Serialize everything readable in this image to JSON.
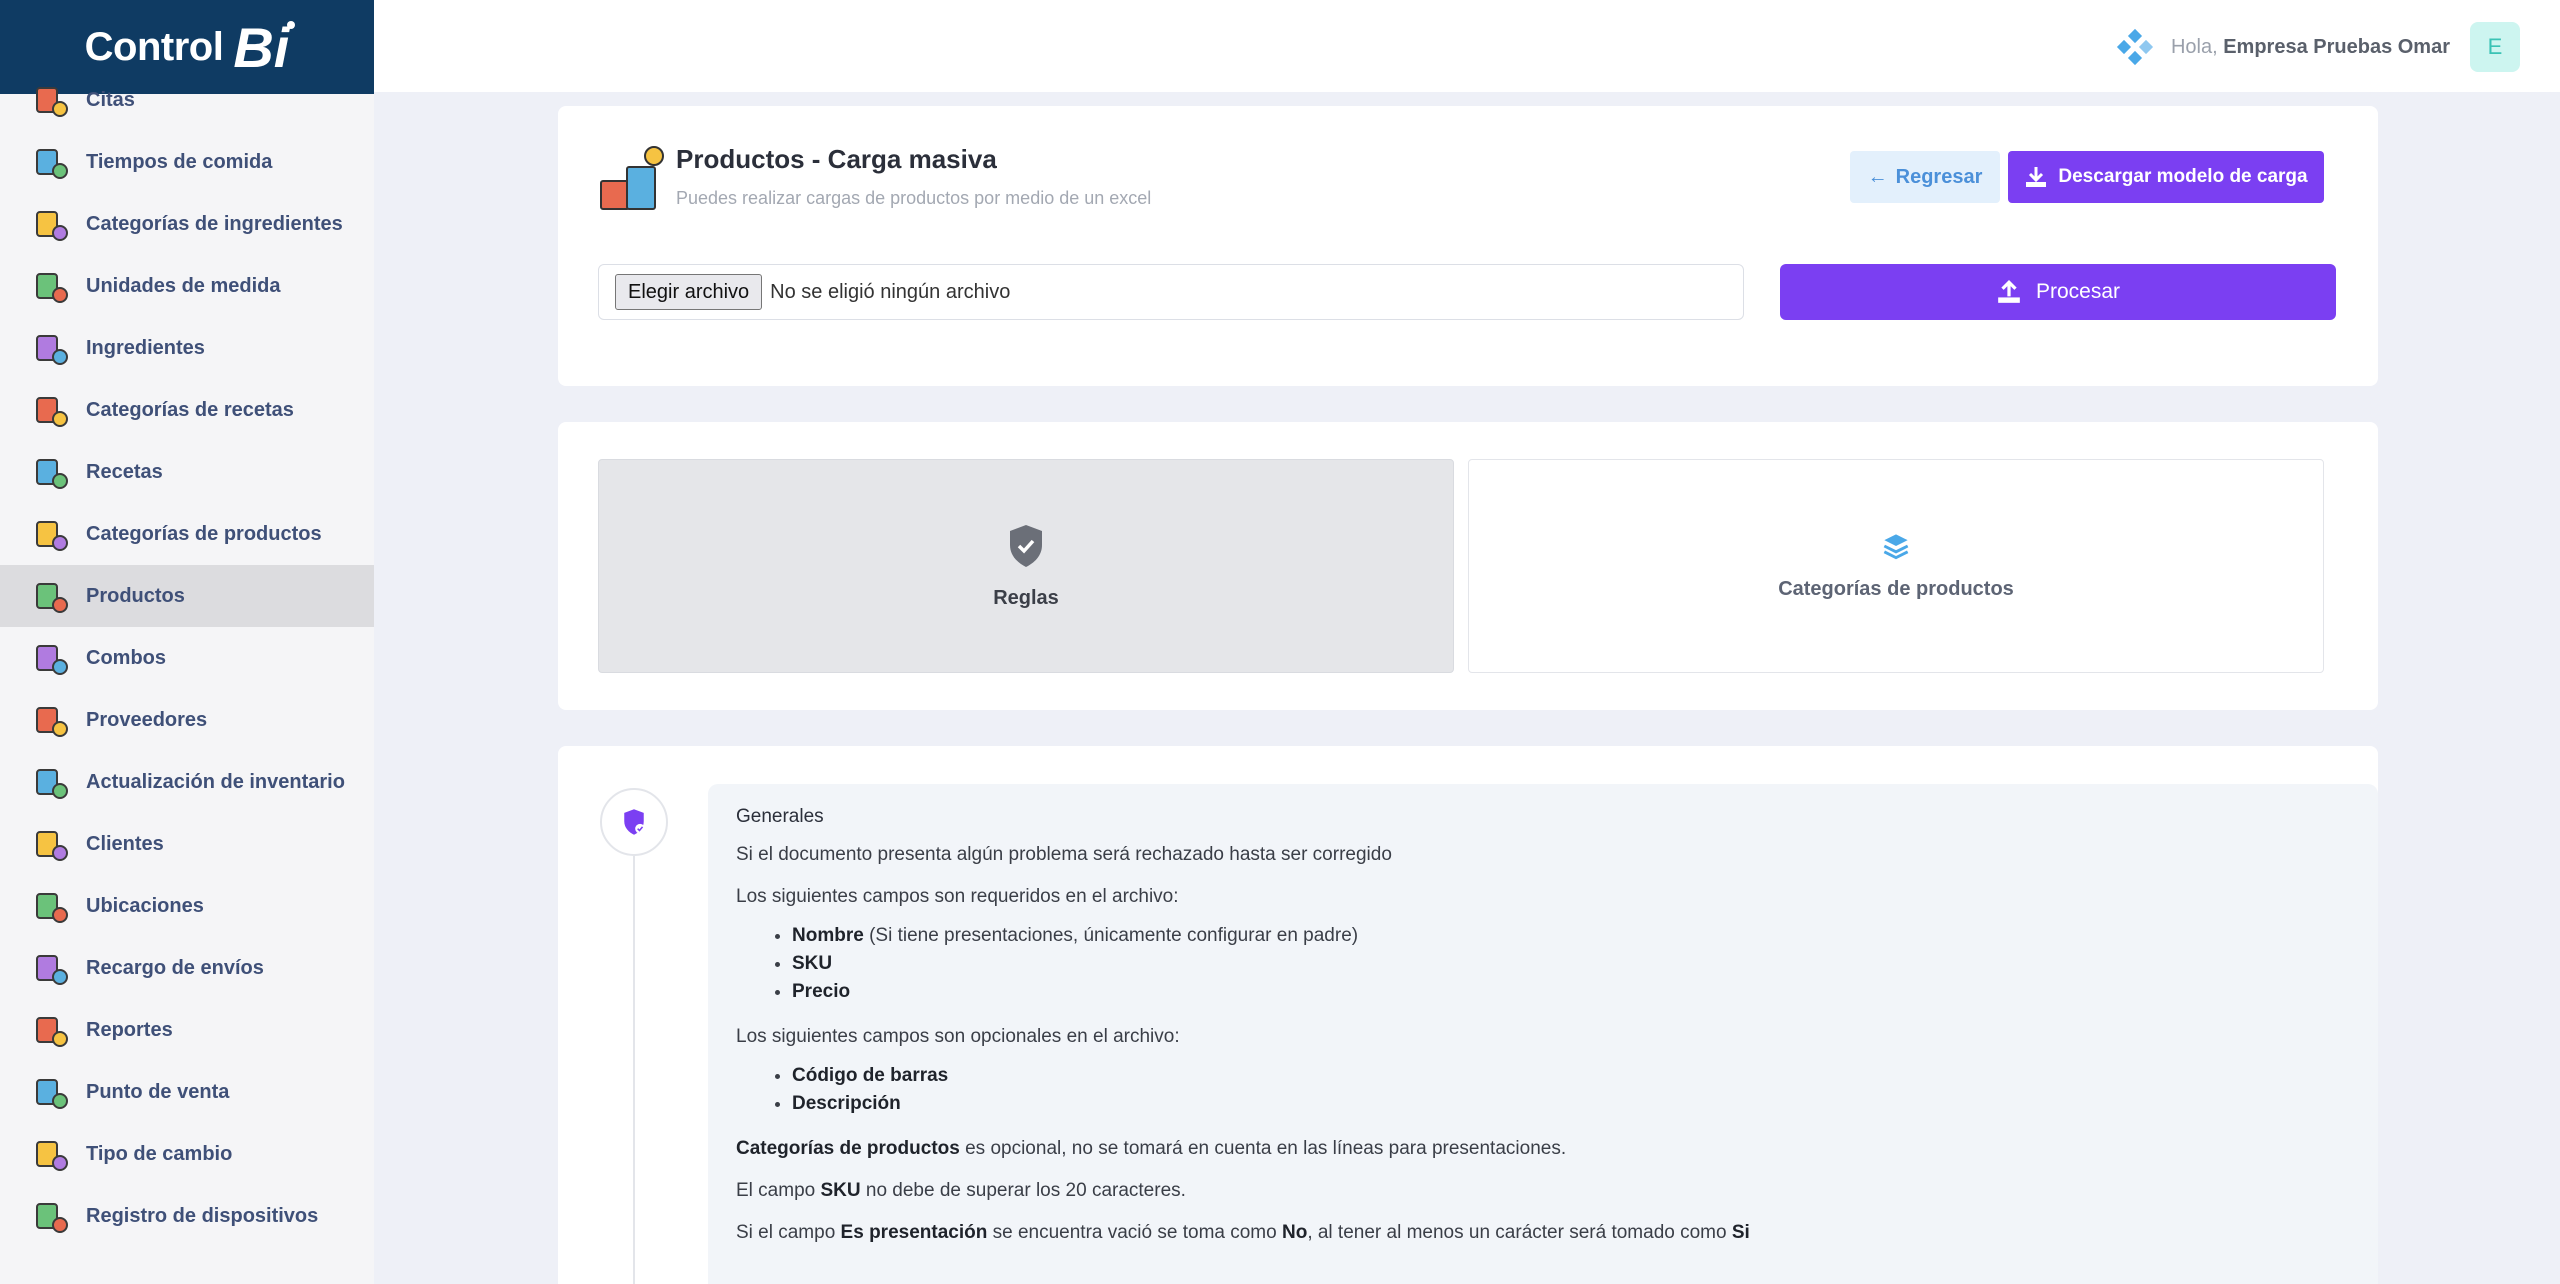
{
  "brand": {
    "text": "Control",
    "mark": "Bi"
  },
  "sidebar": {
    "items": [
      {
        "label": "Citas",
        "icon": "calendar-icon"
      },
      {
        "label": "Tiempos de comida",
        "icon": "plate-icon"
      },
      {
        "label": "Categorías de ingredientes",
        "icon": "ingredients-icon"
      },
      {
        "label": "Unidades de medida",
        "icon": "measure-icon"
      },
      {
        "label": "Ingredientes",
        "icon": "jars-icon"
      },
      {
        "label": "Categorías de recetas",
        "icon": "recipe-book-icon"
      },
      {
        "label": "Recetas",
        "icon": "recipe-icon"
      },
      {
        "label": "Categorías de productos",
        "icon": "product-categories-icon"
      },
      {
        "label": "Productos",
        "icon": "products-icon"
      },
      {
        "label": "Combos",
        "icon": "combo-icon"
      },
      {
        "label": "Proveedores",
        "icon": "supplier-icon"
      },
      {
        "label": "Actualización de inventario",
        "icon": "inventory-icon"
      },
      {
        "label": "Clientes",
        "icon": "clients-icon"
      },
      {
        "label": "Ubicaciones",
        "icon": "location-icon"
      },
      {
        "label": "Recargo de envíos",
        "icon": "delivery-icon"
      },
      {
        "label": "Reportes",
        "icon": "reports-icon"
      },
      {
        "label": "Punto de venta",
        "icon": "pos-icon"
      },
      {
        "label": "Tipo de cambio",
        "icon": "exchange-icon"
      },
      {
        "label": "Registro de dispositivos",
        "icon": "devices-icon"
      }
    ],
    "active": "Productos"
  },
  "topbar": {
    "greeting_prefix": "Hola, ",
    "user_name": "Empresa Pruebas Omar",
    "avatar_letter": "E"
  },
  "upload": {
    "title": "Productos - Carga masiva",
    "subtitle": "Puedes realizar cargas de productos por medio de un excel",
    "back_label": "Regresar",
    "download_label": "Descargar modelo de carga",
    "file_button": "Elegir archivo",
    "file_status": "No se eligió ningún archivo",
    "process_label": "Procesar"
  },
  "tabs": {
    "rules": "Reglas",
    "categories": "Categorías de productos"
  },
  "rules": {
    "heading": "Generales",
    "p1": "Si el documento presenta algún problema será rechazado hasta ser corregido",
    "required_intro": "Los siguientes campos son requeridos en el archivo:",
    "required": [
      {
        "name": "Nombre",
        "note": " (Si tiene presentaciones, únicamente configurar en padre)"
      },
      {
        "name": "SKU",
        "note": ""
      },
      {
        "name": "Precio",
        "note": ""
      }
    ],
    "optional_intro": "Los siguientes campos son opcionales en el archivo:",
    "optional": [
      "Código de barras",
      "Descripción"
    ],
    "p_cat_bold": "Categorías de productos",
    "p_cat_rest": " es opcional, no se tomará en cuenta en las líneas para presentaciones.",
    "p_sku_pre": "El campo ",
    "p_sku_bold": "SKU",
    "p_sku_post": " no debe de superar los 20 caracteres.",
    "p_pres_pre": "Si el campo ",
    "p_pres_bold": "Es presentación",
    "p_pres_mid": " se encuentra vació se toma como ",
    "p_pres_no": "No",
    "p_pres_mid2": ", al tener al menos un carácter será tomado como ",
    "p_pres_si": "Si"
  },
  "colors": {
    "primary": "#7b3ff2",
    "brand_bg": "#0f3b63",
    "back_bg": "#e3f0fc"
  }
}
